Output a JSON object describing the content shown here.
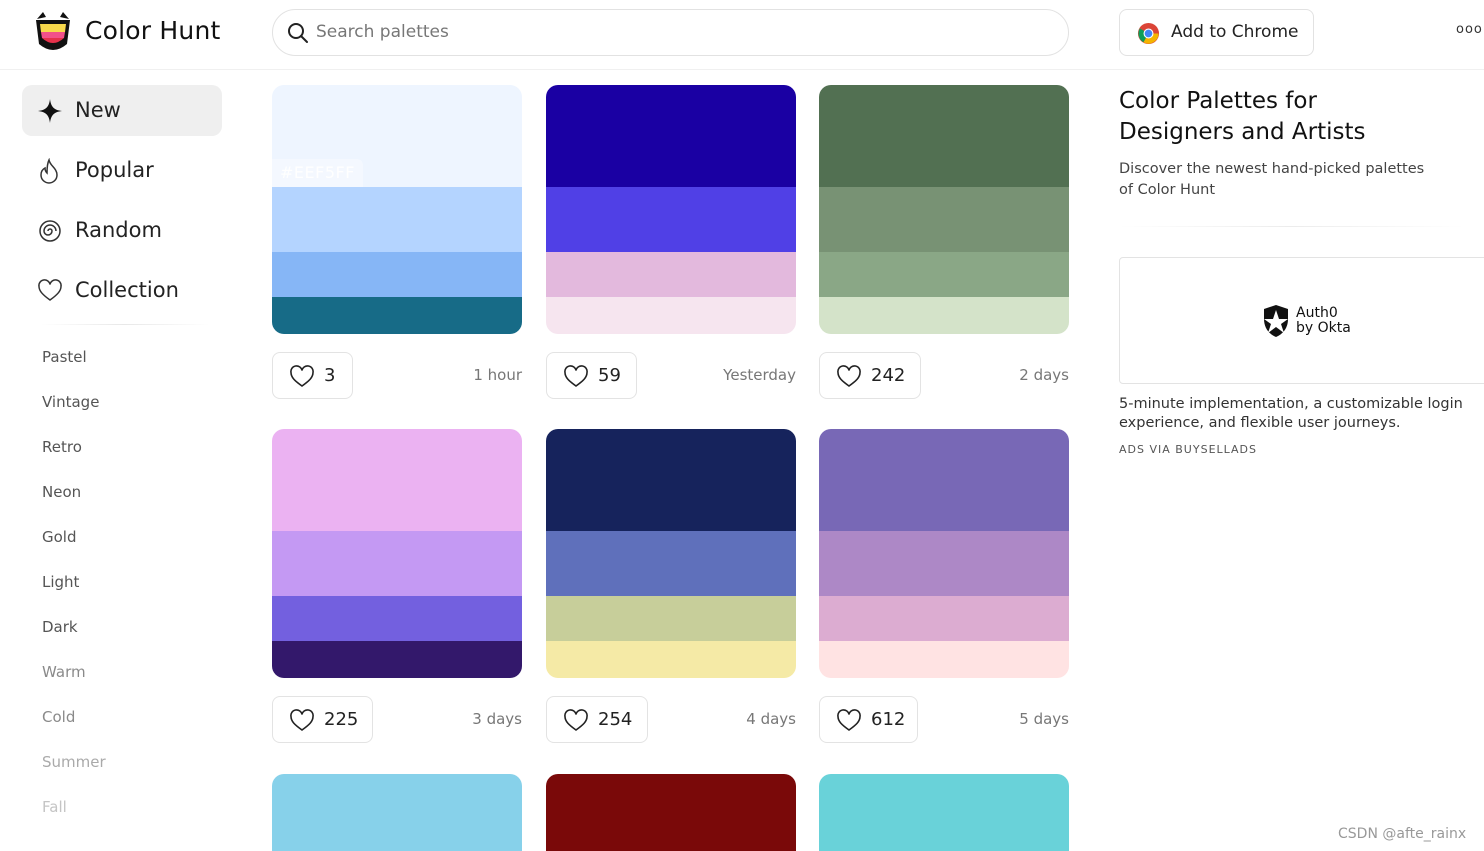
{
  "header": {
    "brand": "Color Hunt",
    "search_placeholder": "Search palettes",
    "chrome_button": "Add to Chrome",
    "more": "ooo"
  },
  "sidebar": {
    "nav": [
      {
        "label": "New",
        "icon": "sparkle-icon",
        "active": true
      },
      {
        "label": "Popular",
        "icon": "flame-icon",
        "active": false
      },
      {
        "label": "Random",
        "icon": "spiral-icon",
        "active": false
      },
      {
        "label": "Collection",
        "icon": "heart-icon",
        "active": false
      }
    ],
    "tags": [
      "Pastel",
      "Vintage",
      "Retro",
      "Neon",
      "Gold",
      "Light",
      "Dark",
      "Warm",
      "Cold",
      "Summer",
      "Fall"
    ]
  },
  "palettes": [
    {
      "colors": [
        "#EEF5FF",
        "#B4D4FF",
        "#86B6F6",
        "#176B87"
      ],
      "likes": "3",
      "time": "1 hour",
      "hover_hex": "#EEF5FF"
    },
    {
      "colors": [
        "#1A00A3",
        "#5040E6",
        "#E3B9DD",
        "#F6E5EF"
      ],
      "likes": "59",
      "time": "Yesterday"
    },
    {
      "colors": [
        "#527052",
        "#789274",
        "#8AA786",
        "#D4E3C9"
      ],
      "likes": "242",
      "time": "2 days"
    },
    {
      "colors": [
        "#EBB2F2",
        "#C499F3",
        "#7360DF",
        "#33186B"
      ],
      "likes": "225",
      "time": "3 days"
    },
    {
      "colors": [
        "#16235C",
        "#5F70BB",
        "#C7CE9A",
        "#F5EAA6"
      ],
      "likes": "254",
      "time": "4 days"
    },
    {
      "colors": [
        "#7868B6",
        "#AD88C6",
        "#DCACD1",
        "#FFE3E3"
      ],
      "likes": "612",
      "time": "5 days"
    }
  ],
  "partial_palettes": [
    "#87D1EA",
    "#7A0909",
    "#69D2D9"
  ],
  "panel": {
    "title": "Color Palettes for Designers and Artists",
    "description": "Discover the newest hand-picked palettes of Color Hunt",
    "ad_brand_line1": "Auth0",
    "ad_brand_line2": "by Okta",
    "ad_text": "5-minute implementation, a customizable login experience, and flexible user journeys.",
    "ad_via": "ADS VIA BUYSELLADS"
  },
  "watermark": "CSDN @afte_rainx"
}
